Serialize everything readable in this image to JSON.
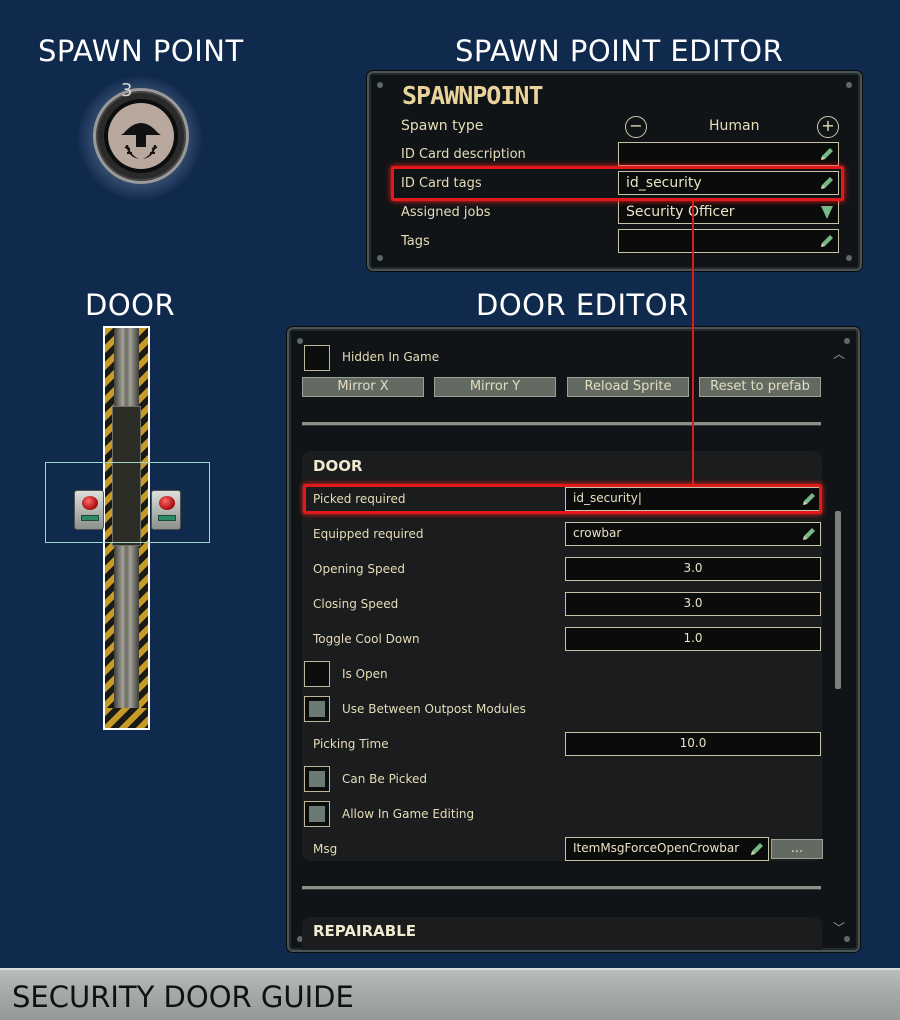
{
  "headings": {
    "spawn_point": "SPAWN POINT",
    "spawn_point_editor": "SPAWN POINT EDITOR",
    "door": "DOOR",
    "door_editor": "DOOR EDITOR"
  },
  "spawn_icon": {
    "count": "3",
    "icon": "human-spawn-icon"
  },
  "spawnpoint_editor": {
    "title": "SPAWNPOINT",
    "spawn_type_label": "Spawn type",
    "spawn_type_value": "Human",
    "id_card_description_label": "ID Card description",
    "id_card_description_value": "",
    "id_card_tags_label": "ID Card tags",
    "id_card_tags_value": "id_security",
    "assigned_jobs_label": "Assigned jobs",
    "assigned_jobs_value": "Security Officer",
    "tags_label": "Tags",
    "tags_value": ""
  },
  "door_editor": {
    "hidden_in_game_label": "Hidden In Game",
    "buttons": {
      "mirror_x": "Mirror X",
      "mirror_y": "Mirror Y",
      "reload_sprite": "Reload Sprite",
      "reset_to_prefab": "Reset to prefab"
    },
    "door_section": {
      "title": "DOOR",
      "picked_required_label": "Picked required",
      "picked_required_value": "id_security|",
      "equipped_required_label": "Equipped required",
      "equipped_required_value": "crowbar",
      "opening_speed_label": "Opening Speed",
      "opening_speed_value": "3.0",
      "closing_speed_label": "Closing Speed",
      "closing_speed_value": "3.0",
      "toggle_cool_down_label": "Toggle Cool Down",
      "toggle_cool_down_value": "1.0",
      "is_open_label": "Is Open",
      "is_open_checked": false,
      "use_between_outpost_label": "Use Between Outpost Modules",
      "use_between_outpost_checked": true,
      "picking_time_label": "Picking Time",
      "picking_time_value": "10.0",
      "can_be_picked_label": "Can Be Picked",
      "can_be_picked_checked": true,
      "allow_in_game_editing_label": "Allow In Game Editing",
      "allow_in_game_editing_checked": true,
      "msg_label": "Msg",
      "msg_value": "ItemMsgForceOpenCrowbar",
      "msg_more_button": "..."
    },
    "next_section_title": "REPAIRABLE"
  },
  "footer": {
    "title": "SECURITY DOOR GUIDE"
  },
  "colors": {
    "background": "#102a4e",
    "highlight": "#e0191b",
    "label_text": "#e6ddb8",
    "title_text": "#e8d49b"
  }
}
